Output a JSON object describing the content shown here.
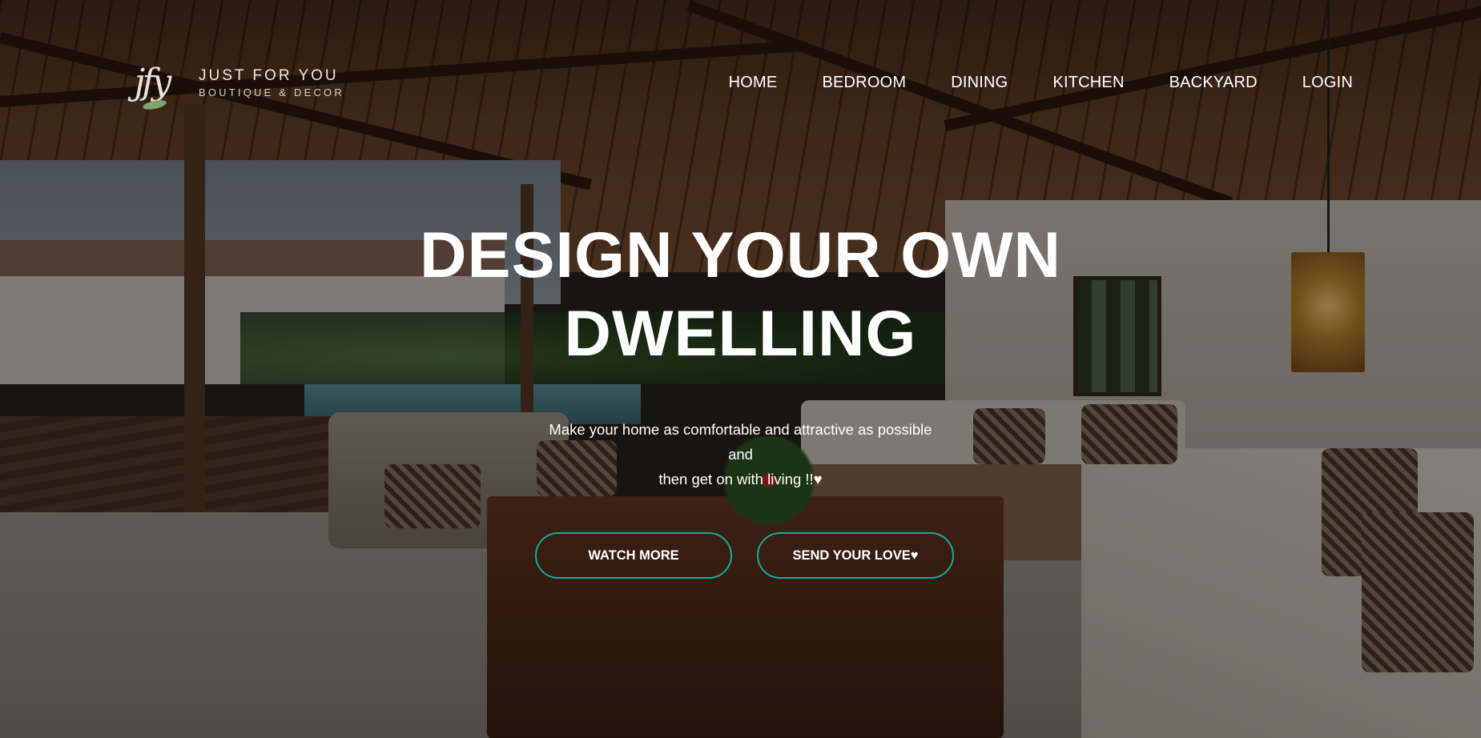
{
  "brand": {
    "monogram": "jfy",
    "title": "JUST FOR YOU",
    "subtitle": "BOUTIQUE & DECOR"
  },
  "nav": {
    "items": [
      {
        "label": "HOME"
      },
      {
        "label": "BEDROOM"
      },
      {
        "label": "DINING"
      },
      {
        "label": "KITCHEN"
      },
      {
        "label": "BACKYARD"
      },
      {
        "label": "LOGIN"
      }
    ]
  },
  "hero": {
    "title": "DESIGN YOUR OWN DWELLING",
    "subtitle_lines": [
      "Make your home as comfortable and attractive as possible",
      "and",
      "then get on with living !!♥"
    ]
  },
  "buttons": {
    "watch_more": "WATCH MORE",
    "send_love": "SEND YOUR LOVE♥"
  },
  "colors": {
    "button_border": "#17a9a0",
    "text": "#ffffff"
  }
}
